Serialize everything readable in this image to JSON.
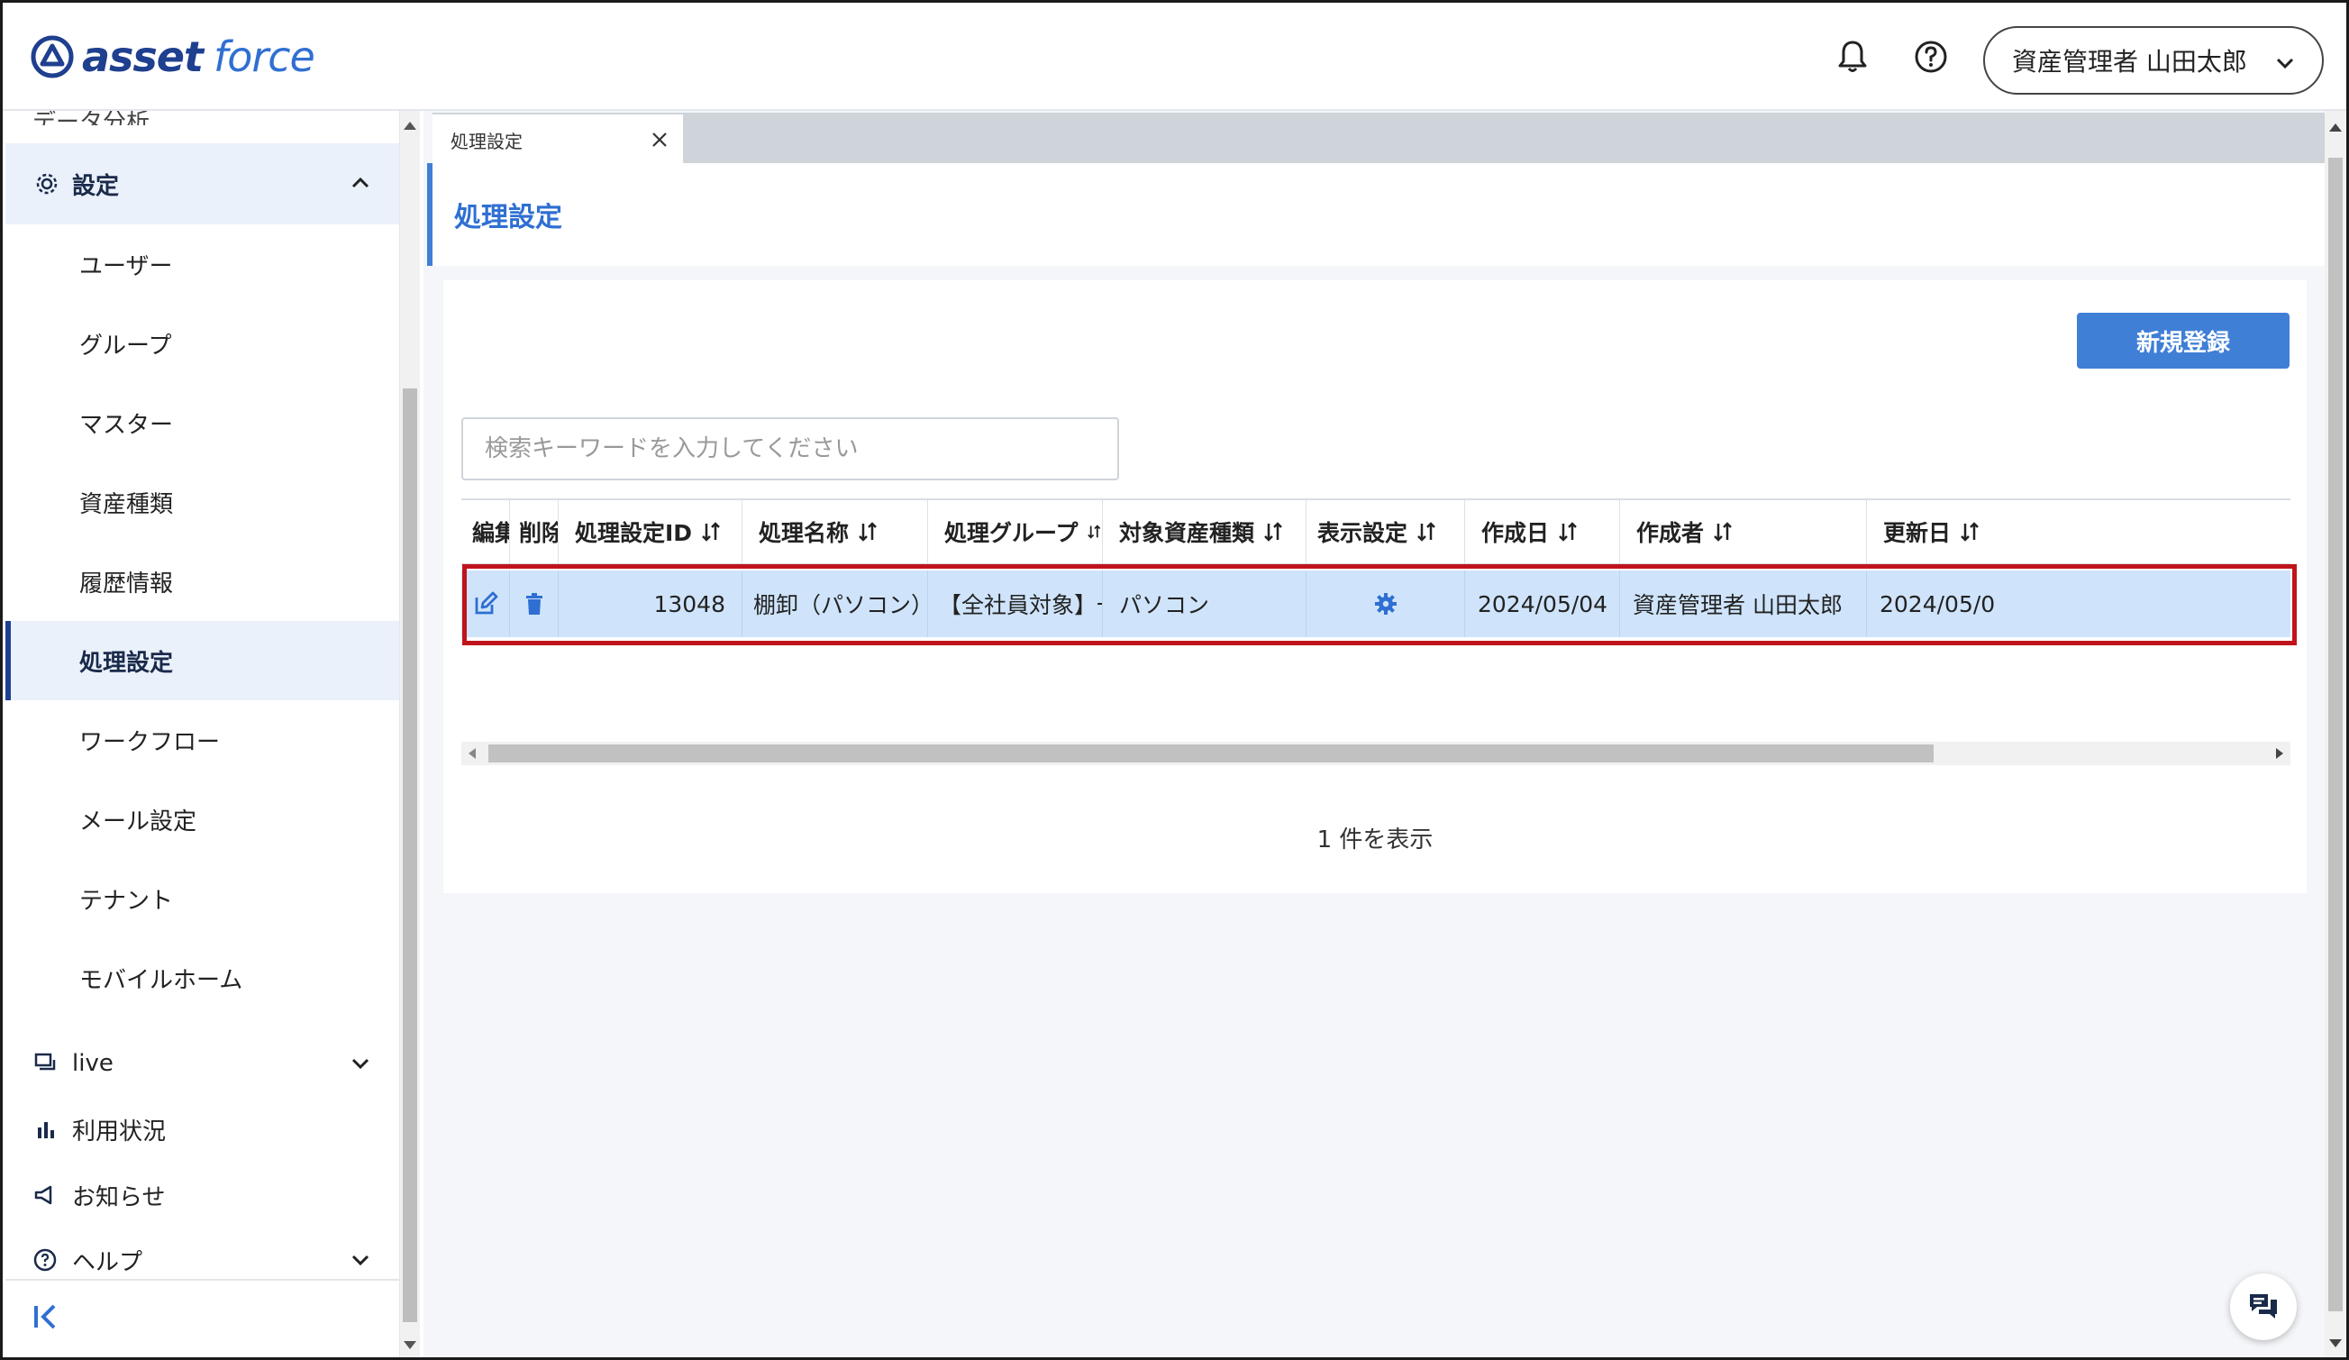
{
  "app": {
    "logo_part1": "asset",
    "logo_part2": "force"
  },
  "header": {
    "user_name": "資産管理者 山田太郎"
  },
  "sidebar": {
    "cut_item_label": "データ分析",
    "settings_group_label": "設定",
    "settings_items": [
      {
        "label": "ユーザー"
      },
      {
        "label": "グループ"
      },
      {
        "label": "マスター"
      },
      {
        "label": "資産種類"
      },
      {
        "label": "履歴情報"
      },
      {
        "label": "処理設定"
      },
      {
        "label": "ワークフロー"
      },
      {
        "label": "メール設定"
      },
      {
        "label": "テナント"
      },
      {
        "label": "モバイルホーム"
      }
    ],
    "bottom_items": [
      {
        "label": "live"
      },
      {
        "label": "利用状況"
      },
      {
        "label": "お知らせ"
      },
      {
        "label": "ヘルプ"
      }
    ]
  },
  "tabs": [
    {
      "label": "処理設定"
    }
  ],
  "page": {
    "title": "処理設定",
    "new_button_label": "新規登録",
    "search_placeholder": "検索キーワードを入力してください",
    "count_text": "1 件を表示"
  },
  "table": {
    "columns": [
      "編集",
      "削除",
      "処理設定ID",
      "処理名称",
      "処理グループ",
      "対象資産種類",
      "表示設定",
      "作成日",
      "作成者",
      "更新日"
    ],
    "rows": [
      {
        "id": "13048",
        "name": "棚卸（パソコン）一括更新",
        "group": "【全社員対象】一括更新",
        "asset_type": "パソコン",
        "created": "2024/05/04",
        "creator": "資産管理者 山田太郎",
        "updated": "2024/05/0"
      }
    ]
  },
  "colors": {
    "brand_dark": "#1f3f8f",
    "brand_blue": "#3f7fd6",
    "row_selected": "#cfe4fb",
    "highlight_border": "#c0141c"
  }
}
